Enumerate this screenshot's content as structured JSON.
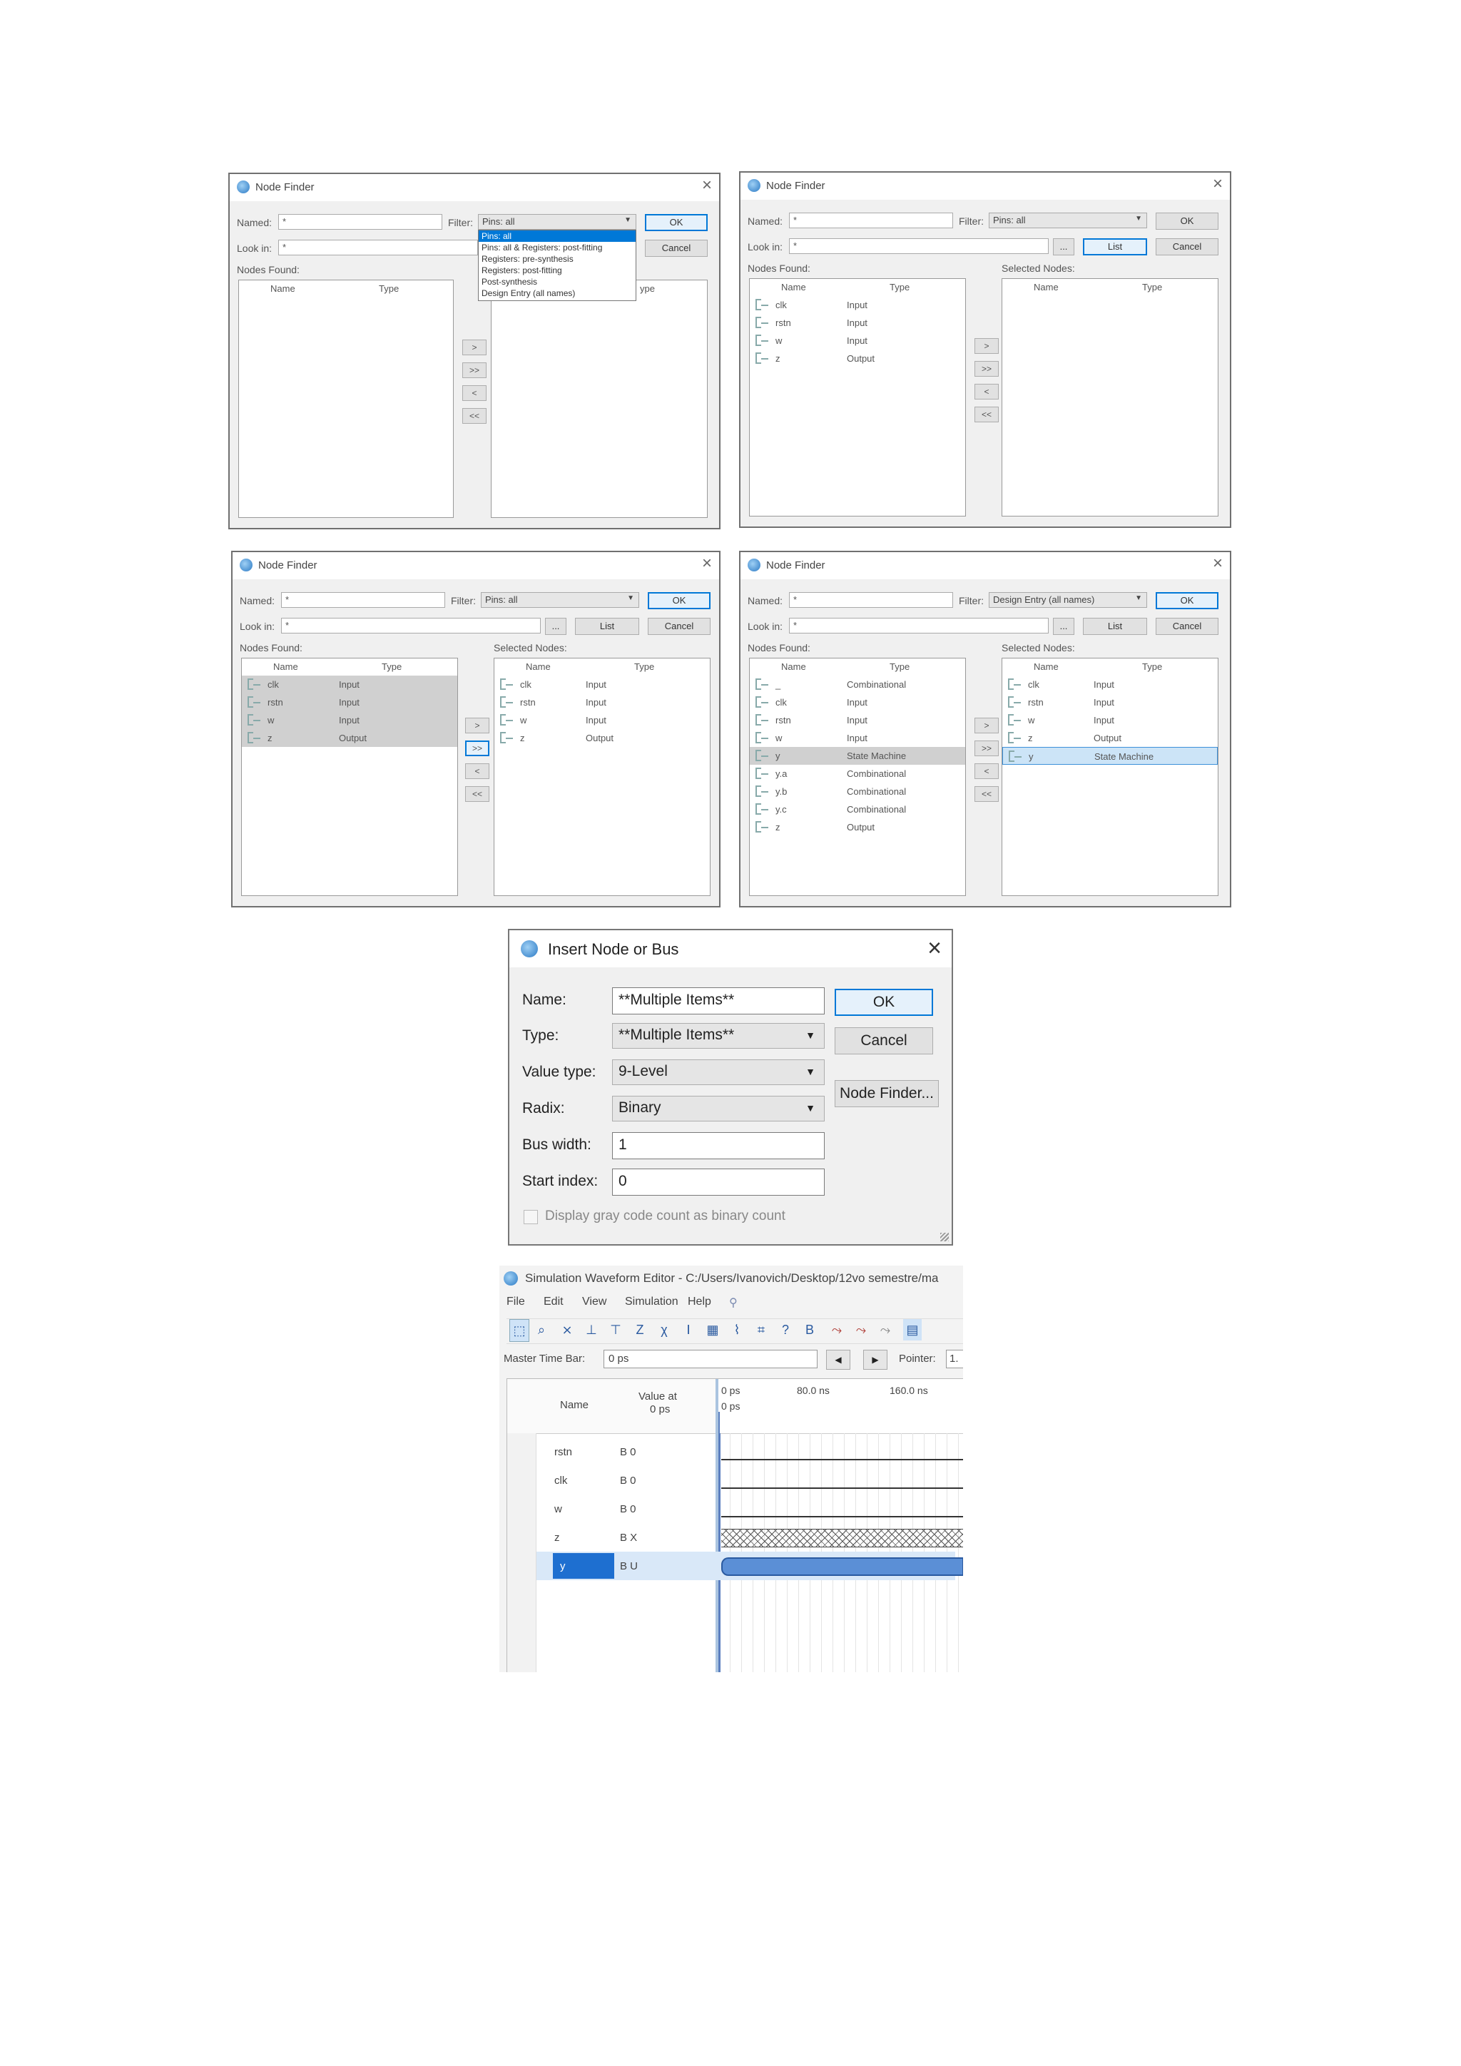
{
  "node_finder": {
    "title": "Node Finder",
    "named_label": "Named:",
    "named_value": "*",
    "filter_label": "Filter:",
    "look_in_label": "Look in:",
    "look_in_value": "*",
    "nodes_found_label": "Nodes Found:",
    "selected_nodes_label": "Selected Nodes:",
    "name_col": "Name",
    "type_col": "Type",
    "ok": "OK",
    "cancel": "Cancel",
    "list": "List",
    "browse": "...",
    "move_right": ">",
    "move_all_right": ">>",
    "move_left": "<",
    "move_all_left": "<<",
    "close": "×"
  },
  "dialog1": {
    "filter_value": "Pins: all",
    "filter_options": [
      "Pins: all",
      "Pins: all & Registers: post-fitting",
      "Registers: pre-synthesis",
      "Registers: post-fitting",
      "Post-synthesis",
      "Design Entry (all names)"
    ],
    "partial_header": "ype"
  },
  "dialog2": {
    "filter_value": "Pins: all",
    "found": [
      {
        "name": "clk",
        "type": "Input"
      },
      {
        "name": "rstn",
        "type": "Input"
      },
      {
        "name": "w",
        "type": "Input"
      },
      {
        "name": "z",
        "type": "Output"
      }
    ]
  },
  "dialog3": {
    "filter_value": "Pins: all",
    "found": [
      {
        "name": "clk",
        "type": "Input"
      },
      {
        "name": "rstn",
        "type": "Input"
      },
      {
        "name": "w",
        "type": "Input"
      },
      {
        "name": "z",
        "type": "Output"
      }
    ],
    "selected": [
      {
        "name": "clk",
        "type": "Input"
      },
      {
        "name": "rstn",
        "type": "Input"
      },
      {
        "name": "w",
        "type": "Input"
      },
      {
        "name": "z",
        "type": "Output"
      }
    ]
  },
  "dialog4": {
    "filter_value": "Design Entry (all names)",
    "found": [
      {
        "name": "_",
        "type": "Combinational"
      },
      {
        "name": "clk",
        "type": "Input"
      },
      {
        "name": "rstn",
        "type": "Input"
      },
      {
        "name": "w",
        "type": "Input"
      },
      {
        "name": "y",
        "type": "State Machine"
      },
      {
        "name": "y.a",
        "type": "Combinational"
      },
      {
        "name": "y.b",
        "type": "Combinational"
      },
      {
        "name": "y.c",
        "type": "Combinational"
      },
      {
        "name": "z",
        "type": "Output"
      }
    ],
    "selected": [
      {
        "name": "clk",
        "type": "Input"
      },
      {
        "name": "rstn",
        "type": "Input"
      },
      {
        "name": "w",
        "type": "Input"
      },
      {
        "name": "z",
        "type": "Output"
      },
      {
        "name": "y",
        "type": "State Machine"
      }
    ]
  },
  "insert_node": {
    "title": "Insert Node or Bus",
    "name_label": "Name:",
    "name_value": "**Multiple Items**",
    "type_label": "Type:",
    "type_value": "**Multiple Items**",
    "value_type_label": "Value type:",
    "value_type_value": "9-Level",
    "radix_label": "Radix:",
    "radix_value": "Binary",
    "bus_width_label": "Bus width:",
    "bus_width_value": "1",
    "start_index_label": "Start index:",
    "start_index_value": "0",
    "gray_code_label": "Display gray code count as binary count",
    "ok": "OK",
    "cancel": "Cancel",
    "node_finder": "Node Finder...",
    "close": "×"
  },
  "waveform": {
    "title": "Simulation Waveform Editor - C:/Users/Ivanovich/Desktop/12vo semestre/ma",
    "menu": [
      "File",
      "Edit",
      "View",
      "Simulation",
      "Help"
    ],
    "master_time_bar_label": "Master Time Bar:",
    "master_time_bar_value": "0 ps",
    "pointer_label": "Pointer:",
    "pointer_value": "1.",
    "name_col": "Name",
    "value_col_line1": "Value at",
    "value_col_line2": "0 ps",
    "time_marks": [
      "0 ps",
      "80.0 ns",
      "160.0 ns"
    ],
    "cursor_label": "0 ps",
    "signals": [
      {
        "name": "rstn",
        "value": "B 0"
      },
      {
        "name": "clk",
        "value": "B 0"
      },
      {
        "name": "w",
        "value": "B 0"
      },
      {
        "name": "z",
        "value": "B X"
      },
      {
        "name": "y",
        "value": "B U"
      }
    ]
  }
}
